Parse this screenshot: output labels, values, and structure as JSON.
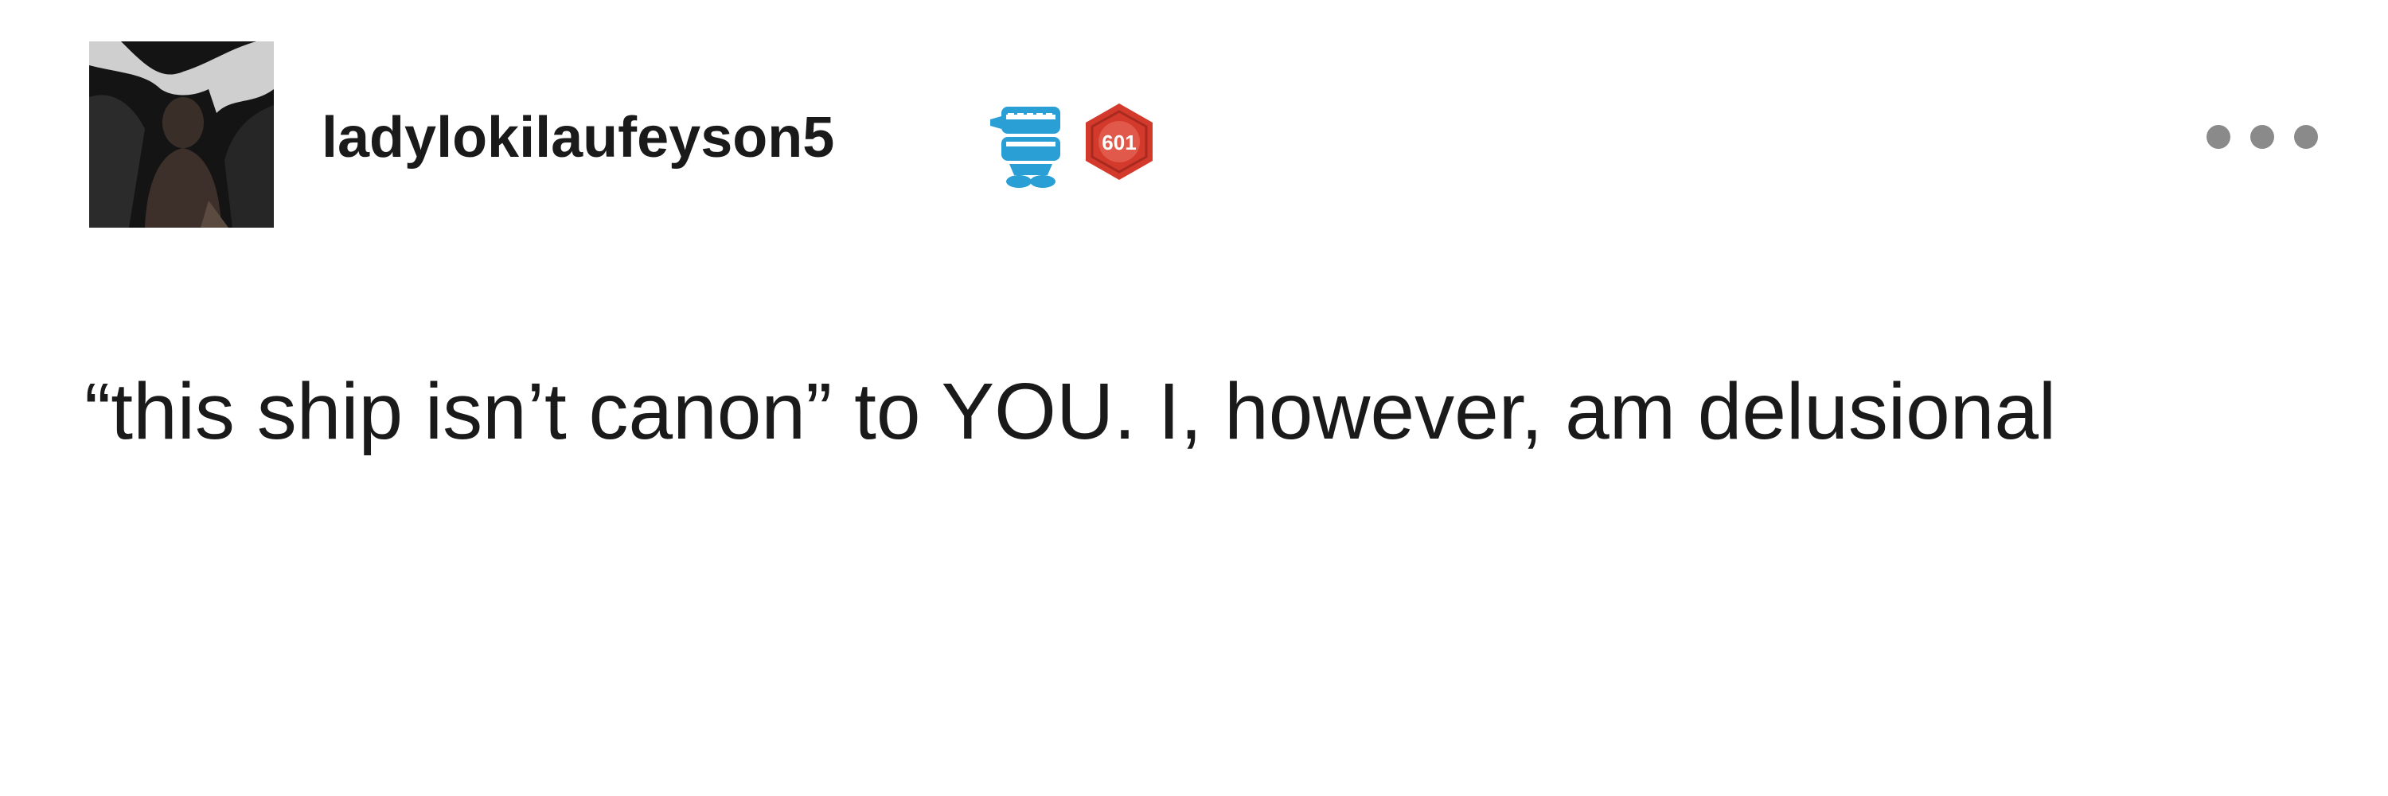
{
  "post": {
    "author": {
      "username": "ladylokilaufeyson5",
      "avatar_icon": "avatar-image",
      "badges": [
        {
          "icon": "chattering-teeth-badge-icon",
          "color": "#2a9fd6"
        },
        {
          "icon": "hexagon-badge-icon",
          "label": "601",
          "color": "#d33a2c"
        }
      ]
    },
    "menu_icon": "more-options-icon",
    "body_text": "“this ship isn’t canon” to YOU. I, however, am delusional"
  }
}
